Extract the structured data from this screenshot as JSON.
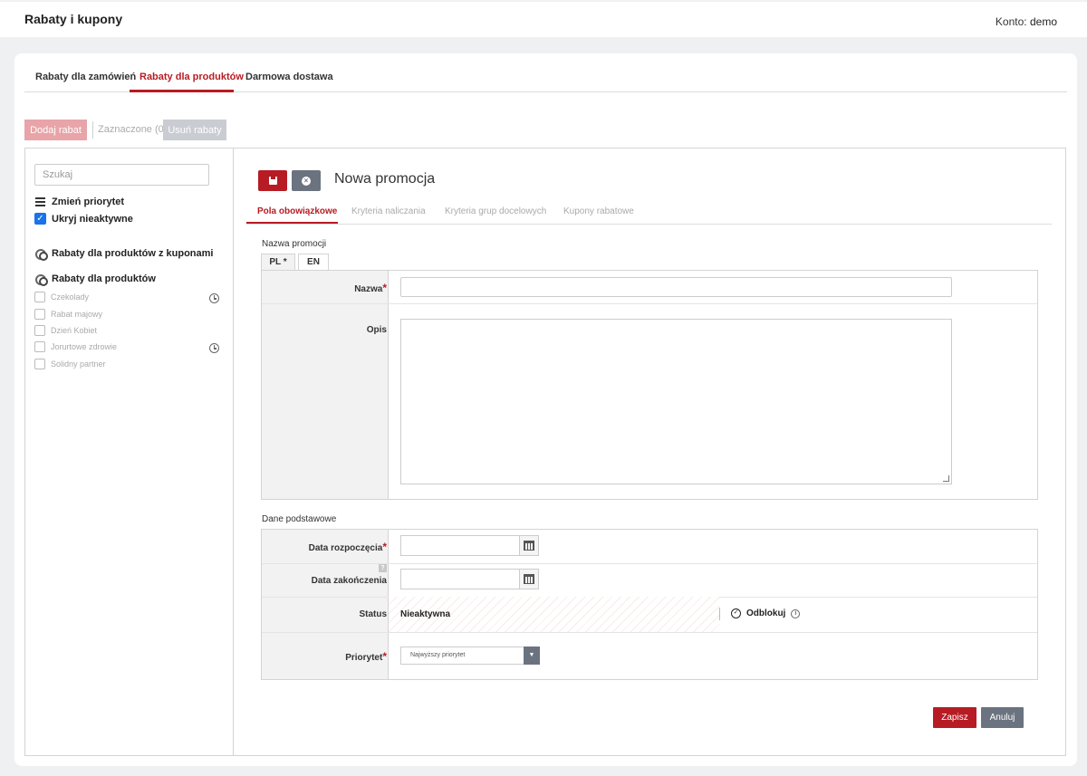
{
  "header": {
    "title": "Rabaty i kupony",
    "account_label": "Konto:",
    "account_name": "demo"
  },
  "tabs": [
    {
      "label": "Rabaty dla zamówień"
    },
    {
      "label": "Rabaty dla produktów"
    },
    {
      "label": "Darmowa dostawa"
    }
  ],
  "active_tab": "Rabaty dla produktów",
  "toolbar": {
    "add_label": "Dodaj rabat",
    "selected_label": "Zaznaczone (0)",
    "remove_label": "Usuń rabaty"
  },
  "sidebar": {
    "search_placeholder": "Szukaj",
    "change_priority": "Zmień priorytet",
    "hide_inactive": "Ukryj nieaktywne",
    "group_coupons": "Rabaty dla produktów z kuponami",
    "group_products": "Rabaty dla produktów",
    "items": [
      {
        "label": "Czekolady",
        "scheduled": true
      },
      {
        "label": "Rabat majowy",
        "scheduled": false
      },
      {
        "label": "Dzień Kobiet",
        "scheduled": false
      },
      {
        "label": "Jorurtowe zdrowie",
        "scheduled": true
      },
      {
        "label": "Solidny partner",
        "scheduled": false
      }
    ]
  },
  "editor": {
    "title": "Nowa promocja",
    "subtabs": [
      {
        "label": "Pola obowiązkowe"
      },
      {
        "label": "Kryteria naliczania"
      },
      {
        "label": "Kryteria grup docelowych"
      },
      {
        "label": "Kupony rabatowe"
      }
    ],
    "section_name": "Nazwa promocji",
    "langs": [
      {
        "label": "PL *"
      },
      {
        "label": "EN"
      }
    ],
    "name_label": "Nazwa",
    "name_value": "",
    "desc_label": "Opis",
    "desc_value": "",
    "section_basic": "Dane podstawowe",
    "start_label": "Data rozpoczęcia",
    "end_label": "Data zakończenia",
    "help_mark": "?",
    "status_label": "Status",
    "status_value": "Nieaktywna",
    "unlock_label": "Odblokuj",
    "priority_label": "Priorytet",
    "priority_value": "Najwyższy priorytet",
    "save_label": "Zapisz",
    "cancel_label": "Anuluj"
  }
}
